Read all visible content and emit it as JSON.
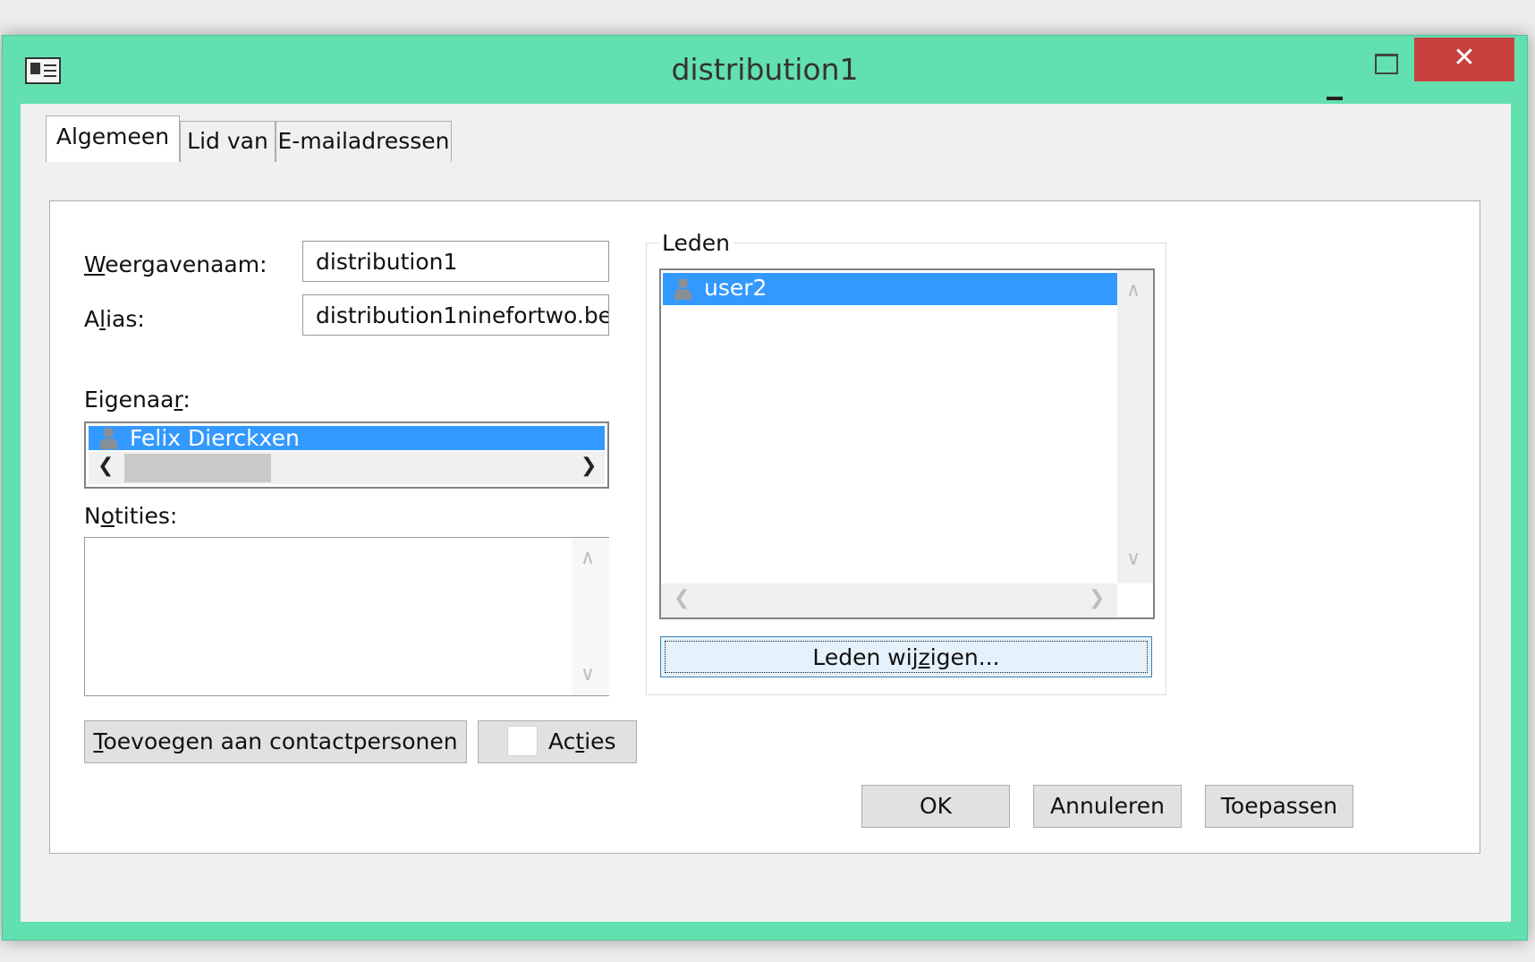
{
  "window": {
    "title": "distribution1",
    "close_glyph": "✕",
    "accent_color": "#63e0b0"
  },
  "tabs": [
    {
      "label": "Algemeen"
    },
    {
      "label": "Lid van"
    },
    {
      "label": "E-mailadressen"
    }
  ],
  "general": {
    "display_name_label_first": "W",
    "display_name_label_rest": "eergavenaam:",
    "display_name_value": "distribution1",
    "alias_label_pre": "A",
    "alias_label_u": "l",
    "alias_label_post": "ias:",
    "alias_value": "distribution1ninefortwo.be",
    "owner_label_pre": "Eigenaa",
    "owner_label_u": "r",
    "owner_label_post": ":",
    "owner_selected": "Felix Dierckxen",
    "notes_label_pre": "N",
    "notes_label_u": "o",
    "notes_label_post": "tities:",
    "notes_value": ""
  },
  "members": {
    "group_label": "Leden",
    "items": [
      {
        "name": "user2",
        "selected": true
      }
    ],
    "modify_button_pre": "Leden wij",
    "modify_button_u": "z",
    "modify_button_post": "igen..."
  },
  "actions": {
    "add_contacts_u": "T",
    "add_contacts_rest": "oevoegen aan contactpersonen",
    "acties_pre": "Ac",
    "acties_u": "t",
    "acties_post": "ies"
  },
  "footer": {
    "ok": "OK",
    "cancel": "Annuleren",
    "apply": "Toepassen"
  }
}
